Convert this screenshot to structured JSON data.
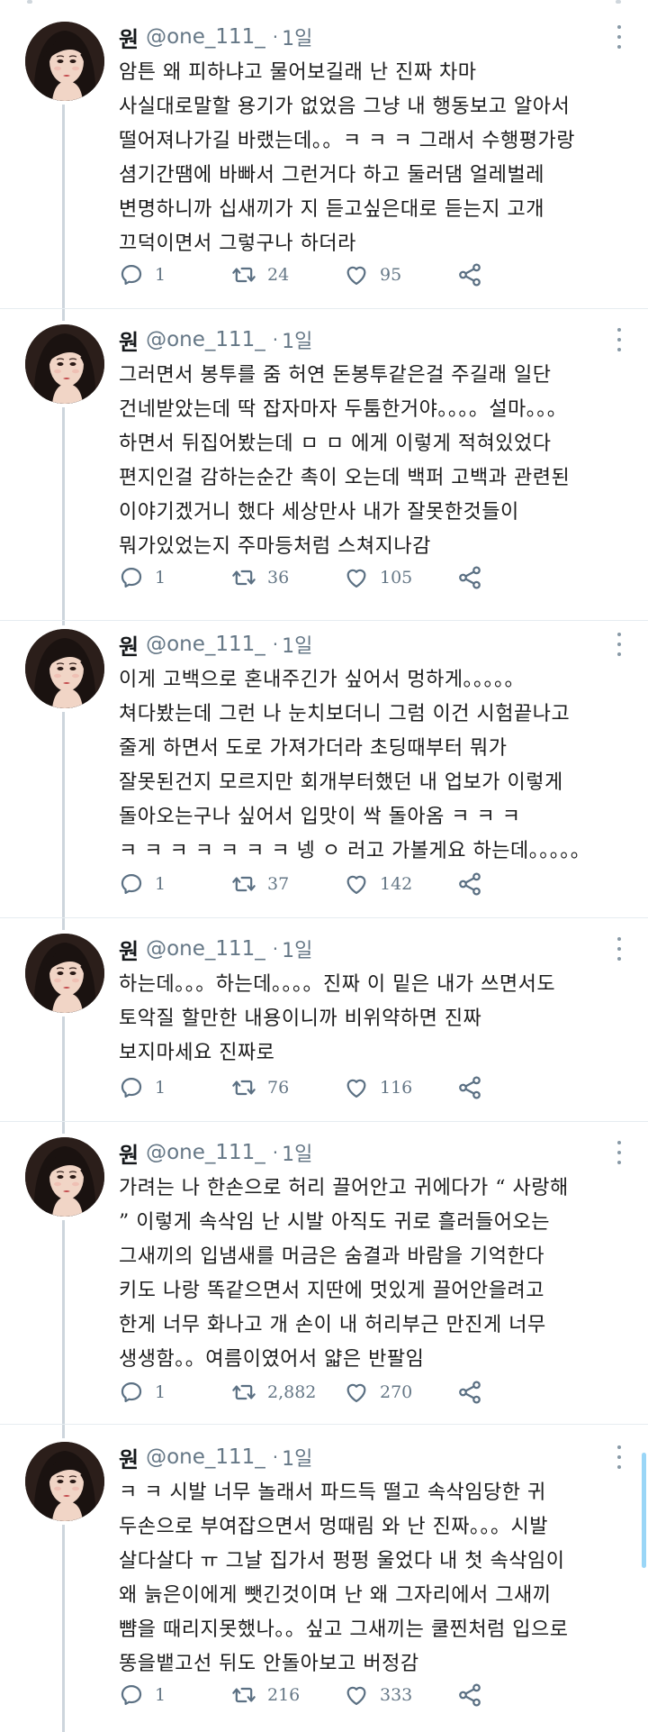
{
  "author": {
    "name": "원",
    "handle": "@one_111_",
    "separator": "·",
    "time": "1일"
  },
  "tweets": [
    {
      "lines": [
        "암튼 왜 피하냐고 물어보길래 난 진짜 차마",
        "사실대로말할 용기가 없었음 그냥 내 행동보고 알아서",
        "떨어져나가길 바랬는데。。ㅋ ㅋ ㅋ 그래서 수행평가랑",
        "셤기간땜에 바빠서 그런거다 하고 둘러댐 얼레벌레",
        "변명하니까 십새끼가 지 듣고싶은대로 듣는지 고개",
        "끄덕이면서 그렇구나 하더라"
      ],
      "replies": "1",
      "retweets": "24",
      "likes": "95"
    },
    {
      "lines": [
        "그러면서 봉투를 줌 허연 돈봉투같은걸 주길래 일단",
        "건네받았는데 딱 잡자마자 두툼한거야。。。。설마。。。",
        "하면서 뒤집어봤는데 ㅁ ㅁ 에게 이렇게 적혀있었다",
        "편지인걸 감하는순간 촉이 오는데 백퍼 고백과 관련된",
        "이야기겠거니 했다 세상만사 내가 잘못한것들이",
        "뭐가있었는지 주마등처럼 스쳐지나감"
      ],
      "replies": "1",
      "retweets": "36",
      "likes": "105"
    },
    {
      "lines": [
        "이게 고백으로 혼내주긴가 싶어서 멍하게。。。。。",
        "쳐다봤는데 그런 나 눈치보더니 그럼 이건 시험끝나고",
        "줄게 하면서 도로 가져가더라 초딩때부터 뭐가",
        "잘못된건지 모르지만 회개부터했던 내 업보가 이렇게",
        "돌아오는구나 싶어서 입맛이 싹 돌아옴 ㅋ ㅋ ㅋ",
        "ㅋ ㅋ ㅋ ㅋ ㅋ  ㅋ ㅋ 넹 ㅇ 러고 가볼게요 하는데。。。。。"
      ],
      "replies": "1",
      "retweets": "37",
      "likes": "142"
    },
    {
      "lines": [
        "하는데。。。하는데。。。。진짜 이 밑은 내가 쓰면서도",
        "토악질 할만한 내용이니까 비위약하면 진짜",
        "보지마세요 진짜로"
      ],
      "replies": "1",
      "retweets": "76",
      "likes": "116"
    },
    {
      "lines": [
        "가려는 나 한손으로 허리 끌어안고 귀에다가 “ 사랑해",
        "” 이렇게 속삭임 난 시발 아직도 귀로 흘러들어오는",
        "그새끼의 입냄새를 머금은 숨결과 바람을 기억한다",
        "키도 나랑 똑같으면서 지딴에 멋있게 끌어안을려고",
        "한게 너무 화나고 개 손이 내 허리부근 만진게 너무",
        "생생함。。여름이였어서 얇은 반팔임"
      ],
      "replies": "1",
      "retweets": "2,882",
      "likes": "270"
    },
    {
      "lines": [
        "ㅋ ㅋ 시발 너무 놀래서 파드득 떨고 속삭임당한 귀",
        "두손으로 부여잡으면서 멍때림 와 난 진짜。。。시발",
        "살다살다 ㅠ 그날 집가서 펑펑 울었다 내 첫 속삭임이",
        "왜 늙은이에게 뺏긴것이며 난 왜 그자리에서 그새끼",
        "뺨을 때리지못했나。。싶고 그새끼는 쿨찐처럼 입으로",
        "똥을뱉고선 뒤도 안돌아보고 버정감"
      ],
      "replies": "1",
      "retweets": "216",
      "likes": "333"
    }
  ],
  "icons": {
    "reply": "reply-icon",
    "retweet": "retweet-icon",
    "like": "heart-icon",
    "share": "share-icon",
    "more": "more-icon"
  },
  "colors": {
    "muted": "#657786",
    "icon": "#5b7083",
    "divider": "#e6ecf0",
    "thread": "#cdd5dc",
    "scroll": "#9ad6f7"
  }
}
